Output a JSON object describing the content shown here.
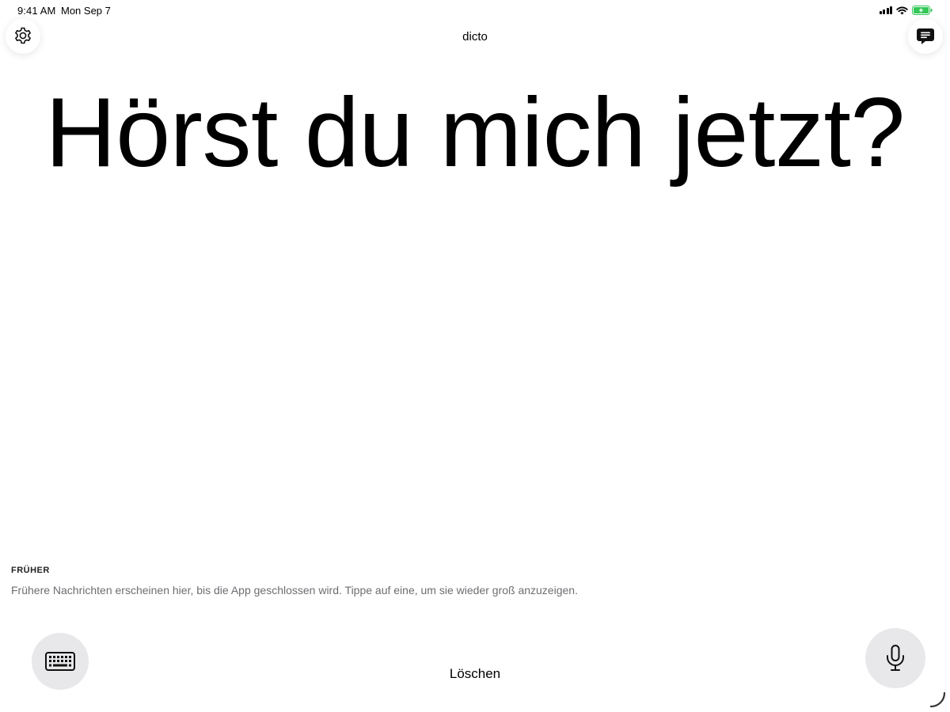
{
  "status_bar": {
    "time": "9:41 AM",
    "date": "Mon Sep 7",
    "icons": [
      "cellular-signal-icon",
      "wifi-icon",
      "battery-charging-icon"
    ]
  },
  "header": {
    "title": "dicto",
    "left_button_icon": "gear-icon",
    "right_button_icon": "message-bubble-icon"
  },
  "main": {
    "text": "Hörst du mich jetzt?"
  },
  "history": {
    "heading": "FRÜHER",
    "hint": "Frühere Nachrichten erscheinen hier, bis die App geschlossen wird. Tippe auf eine, um sie wieder groß anzuzeigen."
  },
  "bottom_bar": {
    "left_button_icon": "keyboard-icon",
    "clear_label": "Löschen",
    "right_button_icon": "microphone-icon"
  },
  "colors": {
    "background": "#ffffff",
    "text": "#000000",
    "secondary_text": "#6e6e73",
    "round_button_bg": "#e8e8ea",
    "battery_fill": "#34c759"
  }
}
